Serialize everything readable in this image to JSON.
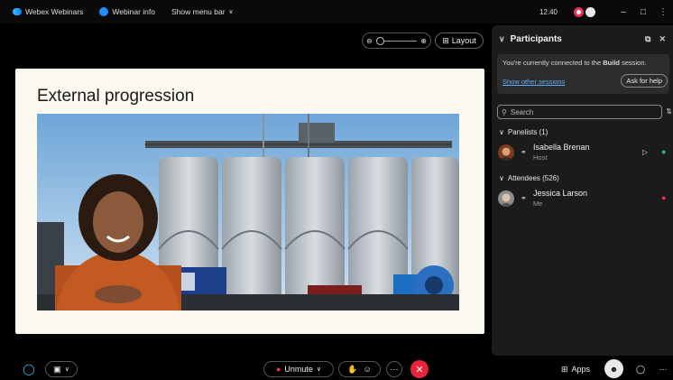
{
  "titlebar": {
    "app_name": "Webex Webinars",
    "info_label": "Webinar info",
    "menu_label": "Show menu bar",
    "time": "12:40"
  },
  "stage": {
    "layout_label": "Layout",
    "slide_title": "External progression"
  },
  "participants": {
    "title": "Participants",
    "banner_prefix": "You're currently connected to the ",
    "banner_session": "Build",
    "banner_suffix": " session.",
    "show_sessions": "Show other sessions",
    "ask_help": "Ask for help",
    "search_placeholder": "Search",
    "panelists_header": "Panelists (1)",
    "attendees_header": "Attendees (526)",
    "panelists": [
      {
        "name": "Isabella Brenan",
        "role": "Host"
      }
    ],
    "attendees": [
      {
        "name": "Jessica Larson",
        "role": "Me"
      }
    ]
  },
  "bottombar": {
    "unmute_label": "Unmute",
    "apps_label": "Apps"
  },
  "colors": {
    "accent_blue": "#1f8dff",
    "end_red": "#e8233a",
    "mic_green": "#25c26e",
    "mic_muted_red": "#f0304a",
    "record_pink": "#f0305a"
  }
}
